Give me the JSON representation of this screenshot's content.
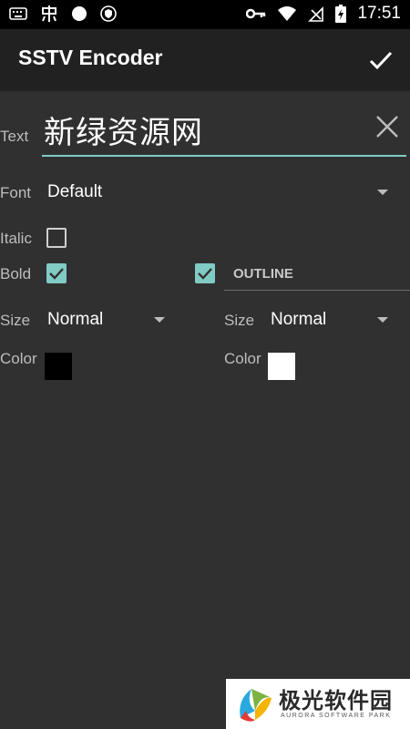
{
  "status_bar": {
    "time": "17:51",
    "left_icons": [
      "keyboard-icon",
      "app-icon",
      "circle-icon",
      "shield-icon"
    ],
    "right_icons": [
      "key-icon",
      "wifi-icon",
      "no-signal-icon",
      "battery-charging-icon"
    ]
  },
  "app_bar": {
    "title": "SSTV Encoder",
    "confirm_icon": "check-icon"
  },
  "form": {
    "text_label": "Text",
    "text_value": "新绿资源网",
    "clear_icon": "close-icon",
    "font_label": "Font",
    "font_value": "Default",
    "italic_label": "Italic",
    "italic_checked": false,
    "bold_label": "Bold",
    "bold_checked": true,
    "outline_checked": true,
    "outline_header": "OUTLINE",
    "size_label": "Size",
    "size_value": "Normal",
    "outline_size_label": "Size",
    "outline_size_value": "Normal",
    "color_label": "Color",
    "color_value": "#000000",
    "outline_color_label": "Color",
    "outline_color_value": "#ffffff"
  },
  "accent_color": "#80cbc4",
  "watermark": {
    "title": "极光软件园",
    "subtitle": "AURORA SOFTWARE PARK"
  }
}
